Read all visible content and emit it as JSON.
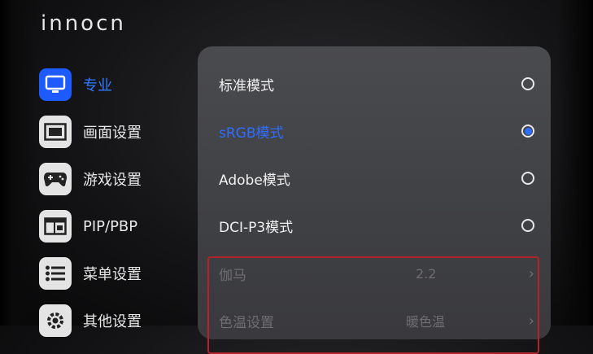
{
  "brand": {
    "logo_text": "innocn"
  },
  "sidebar": {
    "items": [
      {
        "label": "专业",
        "icon": "monitor-icon",
        "active": true
      },
      {
        "label": "画面设置",
        "icon": "screen-frame-icon",
        "active": false
      },
      {
        "label": "游戏设置",
        "icon": "gamepad-icon",
        "active": false
      },
      {
        "label": "PIP/PBP",
        "icon": "pip-icon",
        "active": false
      },
      {
        "label": "菜单设置",
        "icon": "menu-list-icon",
        "active": false
      },
      {
        "label": "其他设置",
        "icon": "gear-icon",
        "active": false
      }
    ]
  },
  "panel": {
    "modes": [
      {
        "label": "标准模式",
        "selected": false
      },
      {
        "label": "sRGB模式",
        "selected": true
      },
      {
        "label": "Adobe模式",
        "selected": false
      },
      {
        "label": "DCI-P3模式",
        "selected": false
      }
    ],
    "gamma": {
      "label": "伽马",
      "value": "2.2"
    },
    "color_temp": {
      "label": "色温设置",
      "value": "暖色温"
    }
  },
  "colors": {
    "accent": "#2f6dff",
    "highlight_border": "#b0252a",
    "panel_bg": "#45464a"
  }
}
